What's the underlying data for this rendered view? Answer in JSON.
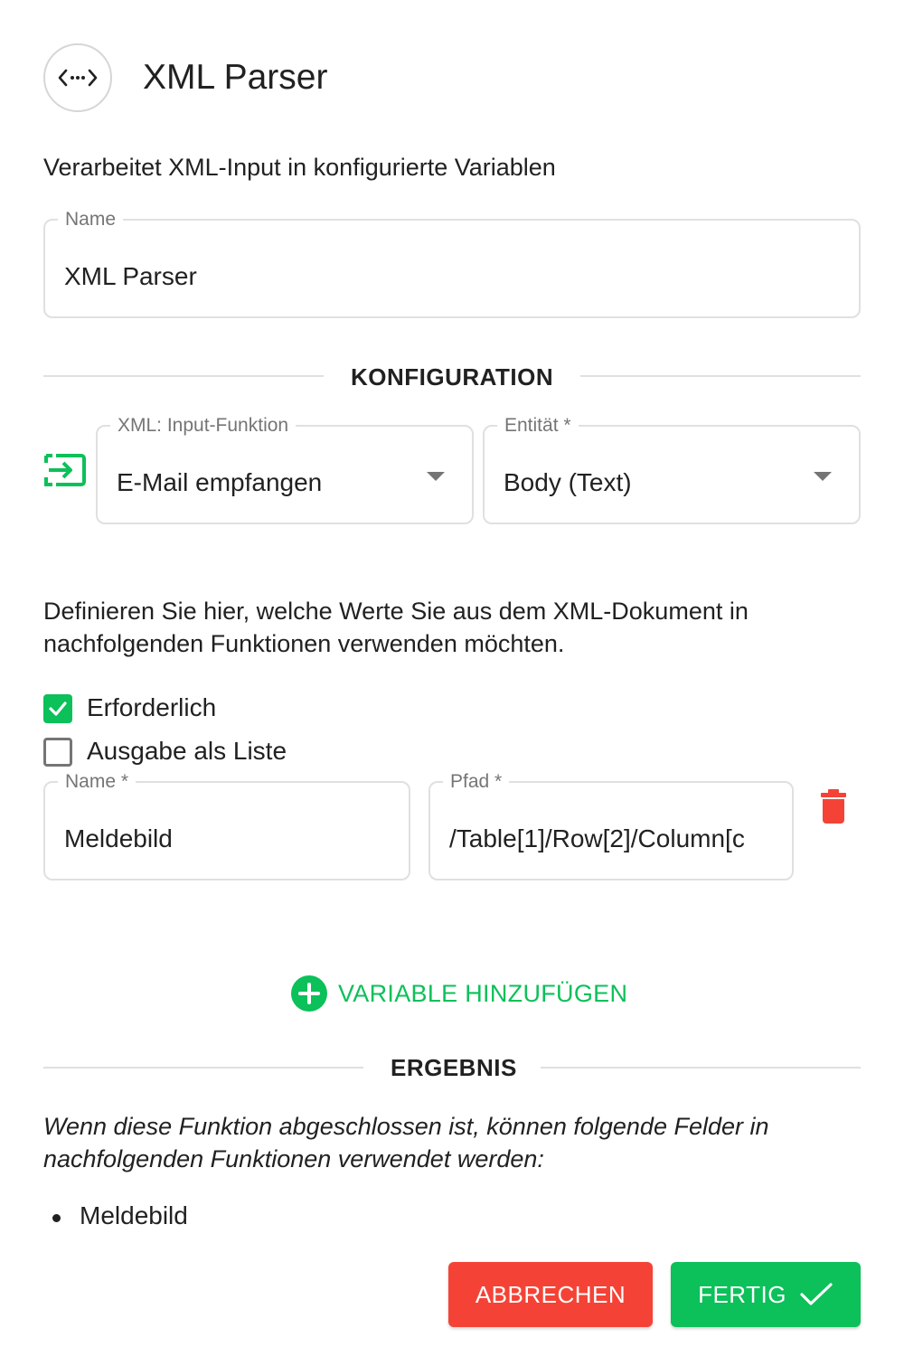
{
  "header": {
    "title": "XML Parser",
    "icon": "code-icon",
    "description": "Verarbeitet XML-Input in konfigurierte Variablen"
  },
  "name_field": {
    "label": "Name",
    "value": "XML Parser"
  },
  "config": {
    "section_title": "KONFIGURATION",
    "input_icon": "input-icon",
    "input_function": {
      "label": "XML: Input-Funktion",
      "value": "E-Mail empfangen"
    },
    "entity": {
      "label": "Entität *",
      "value": "Body (Text)"
    }
  },
  "variables": {
    "instruction": "Definieren Sie hier, welche Werte Sie aus dem XML-Dokument in nachfolgenden Funktionen verwenden möchten.",
    "required": {
      "label": "Erforderlich",
      "checked": true
    },
    "as_list": {
      "label": "Ausgabe als Liste",
      "checked": false
    },
    "name": {
      "label": "Name *",
      "value": "Meldebild"
    },
    "path": {
      "label": "Pfad *",
      "value": "/Table[1]/Row[2]/Column[c"
    },
    "add_label": "VARIABLE HINZUFÜGEN"
  },
  "result": {
    "section_title": "ERGEBNIS",
    "text": "Wenn diese Funktion abgeschlossen ist, können folgende Felder in nachfolgenden Funktionen verwendet werden:",
    "items": [
      "Meldebild"
    ]
  },
  "footer": {
    "cancel_label": "ABBRECHEN",
    "done_label": "FERTIG"
  },
  "colors": {
    "accent_green": "#0cc05a",
    "danger_red": "#f44336",
    "text": "#212121",
    "muted": "#757575",
    "border": "#e0e0e0"
  }
}
